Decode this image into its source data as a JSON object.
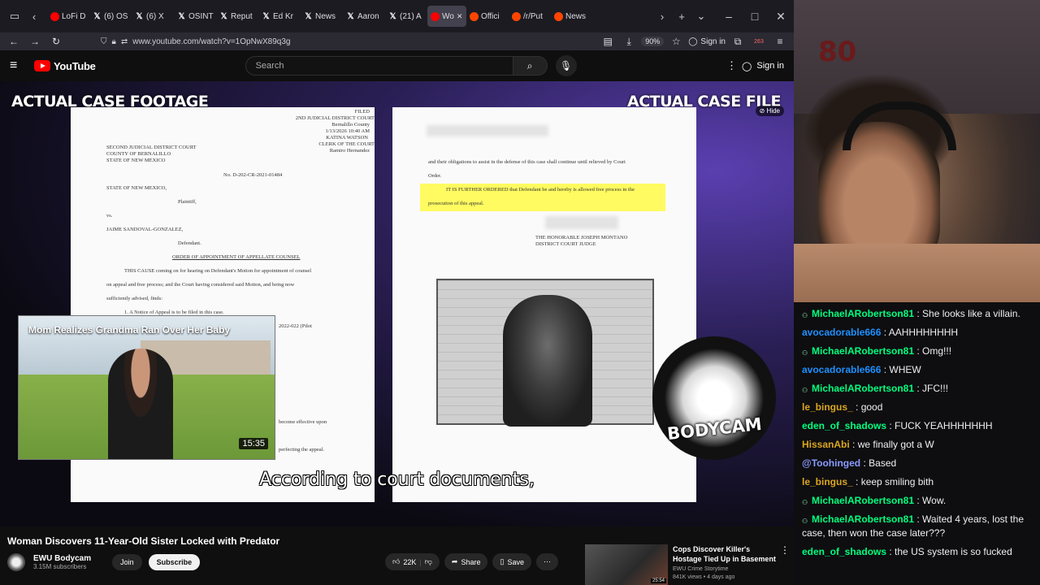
{
  "browser": {
    "tabs": [
      {
        "favicon": "yt",
        "label": "LoFi D"
      },
      {
        "favicon": "x",
        "label": "(6) OS"
      },
      {
        "favicon": "x",
        "label": "(6) X"
      },
      {
        "favicon": "x",
        "label": "OSINT"
      },
      {
        "favicon": "x",
        "label": "Reput"
      },
      {
        "favicon": "x",
        "label": "Ed Kr"
      },
      {
        "favicon": "x",
        "label": "News"
      },
      {
        "favicon": "x",
        "label": "Aaron"
      },
      {
        "favicon": "x",
        "label": "(21) A"
      },
      {
        "favicon": "yt",
        "label": "Wo"
      },
      {
        "favicon": "rd",
        "label": "Offici"
      },
      {
        "favicon": "rd",
        "label": "/r/Put"
      },
      {
        "favicon": "rd",
        "label": "News"
      }
    ],
    "url": "www.youtube.com/watch?v=1OpNwX89q3g",
    "zoom": "90%",
    "sign_in": "Sign in",
    "badge_count": "263"
  },
  "youtube": {
    "logo_text": "YouTube",
    "search_placeholder": "Search",
    "sign_in": "Sign in"
  },
  "video": {
    "label_left": "ACTUAL CASE FOOTAGE",
    "label_right": "ACTUAL CASE FILE",
    "hide_label": "Hide",
    "subtitle": "According to court documents,",
    "brand_logo_text": "BODYCAM",
    "doc_left": {
      "filed": "FILED",
      "court_right": "2ND JUDICIAL DISTRICT COURT",
      "county_right": "Bernalillo County",
      "date": "1/13/2026 10:40 AM",
      "clerk": "KATINA WATSON",
      "clerk_title": "CLERK OF THE COURT",
      "clerk_name": "Ramiro Hernandez",
      "court": "SECOND JUDICIAL DISTRICT COURT",
      "county": "COUNTY OF BERNALILLO",
      "state": "STATE OF NEW MEXICO",
      "case_no": "No. D-202-CR-2021-01484",
      "plaintiff_name": "STATE OF NEW MEXICO,",
      "plaintiff": "Plaintiff,",
      "vs": "vs.",
      "defendant_name": "JAIME SANDOVAL-GONZALEZ,",
      "defendant": "Defendant.",
      "order_title": "ORDER OF APPOINTMENT OF APPELLATE COUNSEL",
      "line1": "THIS CAUSE coming on for hearing on Defendant's Motion for appointment of counsel",
      "line2": "on appeal and free process; and the Court having considered said Motion, and being now",
      "line3": "sufficiently advised, finds:",
      "line4": "1.   A Notice of Appeal is to be filed in this case.",
      "frag1": "2022-022 (Pilot",
      "frag2": "become effective upon",
      "frag3": "perfecting the appeal."
    },
    "doc_right": {
      "line1": "and their obligations to assist in the defense of this case shall continue until relieved by Court",
      "line2": "Order.",
      "highlight1": "IT IS FURTHER ORDERED that Defendant be and hereby is allowed free process in the",
      "highlight2": "prosecution of this appeal.",
      "judge": "THE HONORABLE JOSEPH MONTANO",
      "judge_title": "DISTRICT COURT JUDGE"
    },
    "miniplayer": {
      "title": "Mom Realizes Grandma Ran Over Her Baby",
      "duration": "15:35"
    }
  },
  "watch": {
    "title": "Woman Discovers 11-Year-Old Sister Locked with Predator",
    "channel": "EWU Bodycam",
    "subscribers": "3.15M subscribers",
    "join": "Join",
    "subscribe": "Subscribe",
    "likes": "22K",
    "share": "Share",
    "save": "Save",
    "recommended": {
      "title": "Cops Discover Killer's Hostage Tied Up in Basement",
      "channel": "EWU Crime Storytime",
      "meta": "841K views • 4 days ago",
      "duration": "25:54"
    }
  },
  "webcam": {
    "wall_text": "80"
  },
  "chat": [
    {
      "user": "MichaelARobertson81",
      "color": "#00ff7f",
      "badge": true,
      "text": "She looks like a villain."
    },
    {
      "user": "avocadorable666",
      "color": "#1e90ff",
      "badge": false,
      "text": "AAHHHHHHHH"
    },
    {
      "user": "MichaelARobertson81",
      "color": "#00ff7f",
      "badge": true,
      "text": "Omg!!!"
    },
    {
      "user": "avocadorable666",
      "color": "#1e90ff",
      "badge": false,
      "text": "WHEW"
    },
    {
      "user": "MichaelARobertson81",
      "color": "#00ff7f",
      "badge": true,
      "text": "JFC!!!"
    },
    {
      "user": "le_bingus_",
      "color": "#daa520",
      "badge": false,
      "text": "good"
    },
    {
      "user": "eden_of_shadows",
      "color": "#00ff7f",
      "badge": false,
      "text": "FUCK YEAHHHHHHH"
    },
    {
      "user": "HissanAbi",
      "color": "#daa520",
      "badge": false,
      "text": "we finally got a W"
    },
    {
      "user": "@Toohinged",
      "color": "#8a9bff",
      "badge": false,
      "text": "Based"
    },
    {
      "user": "le_bingus_",
      "color": "#daa520",
      "badge": false,
      "text": "keep smiling bith"
    },
    {
      "user": "MichaelARobertson81",
      "color": "#00ff7f",
      "badge": true,
      "text": "Wow."
    },
    {
      "user": "MichaelARobertson81",
      "color": "#00ff7f",
      "badge": true,
      "text": "Waited 4 years, lost the case, then won the case later???"
    },
    {
      "user": "eden_of_shadows",
      "color": "#00ff7f",
      "badge": false,
      "text": "the US system is so fucked"
    }
  ]
}
